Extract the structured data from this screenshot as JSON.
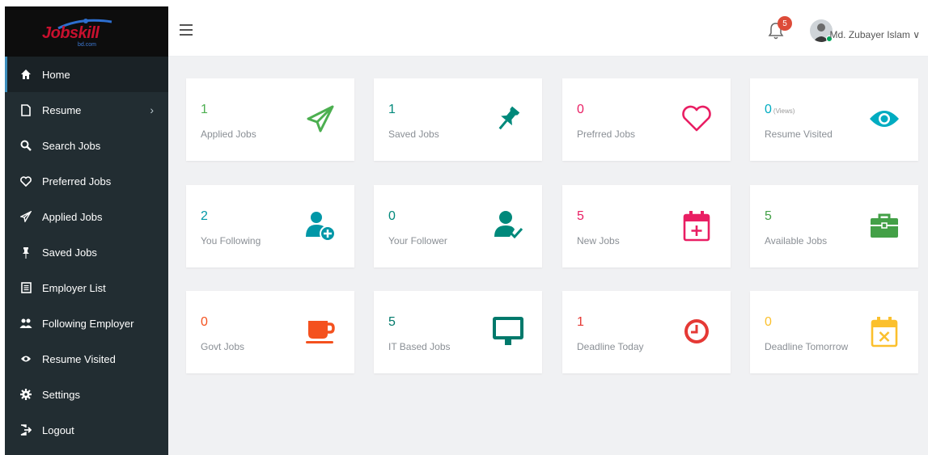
{
  "brand": {
    "logo_text": "Jobskill",
    "logo_sub": "bd.com"
  },
  "sidebar": {
    "items": [
      {
        "label": "Home",
        "icon": "home-icon"
      },
      {
        "label": "Resume",
        "icon": "file-icon"
      },
      {
        "label": "Search Jobs",
        "icon": "search-icon"
      },
      {
        "label": "Preferred Jobs",
        "icon": "heart-icon"
      },
      {
        "label": "Applied Jobs",
        "icon": "paper-plane-icon"
      },
      {
        "label": "Saved Jobs",
        "icon": "pushpin-icon"
      },
      {
        "label": "Employer List",
        "icon": "list-icon"
      },
      {
        "label": "Following Employer",
        "icon": "users-icon"
      },
      {
        "label": "Resume Visited",
        "icon": "eye-icon"
      },
      {
        "label": "Settings",
        "icon": "gear-icon"
      },
      {
        "label": "Logout",
        "icon": "logout-icon"
      }
    ],
    "chevron": "›"
  },
  "header": {
    "notification_count": "5",
    "user_name": "Md. Zubayer Islam ∨"
  },
  "cards": [
    {
      "value": "1",
      "suffix": "",
      "label": "Applied Jobs",
      "color": "#4caf50",
      "icon": "paper-plane-icon"
    },
    {
      "value": "1",
      "suffix": "",
      "label": "Saved Jobs",
      "color": "#00897b",
      "icon": "pushpin-icon"
    },
    {
      "value": "0",
      "suffix": "",
      "label": "Prefrred Jobs",
      "color": "#e91e63",
      "icon": "heart-icon"
    },
    {
      "value": "0",
      "suffix": "(Views)",
      "label": "Resume Visited",
      "color": "#00acc1",
      "icon": "eye-icon"
    },
    {
      "value": "2",
      "suffix": "",
      "label": "You Following",
      "color": "#0097a7",
      "icon": "add-user-icon"
    },
    {
      "value": "0",
      "suffix": "",
      "label": "Your Follower",
      "color": "#00897b",
      "icon": "user-check-icon"
    },
    {
      "value": "5",
      "suffix": "",
      "label": "New Jobs",
      "color": "#e91e63",
      "icon": "calendar-plus-icon"
    },
    {
      "value": "5",
      "suffix": "",
      "label": "Available Jobs",
      "color": "#43a047",
      "icon": "briefcase-icon"
    },
    {
      "value": "0",
      "suffix": "",
      "label": "Govt Jobs",
      "color": "#f4511e",
      "icon": "coffee-cup-icon"
    },
    {
      "value": "5",
      "suffix": "",
      "label": "IT Based Jobs",
      "color": "#00796b",
      "icon": "monitor-icon"
    },
    {
      "value": "1",
      "suffix": "",
      "label": "Deadline Today",
      "color": "#e53935",
      "icon": "clock-icon"
    },
    {
      "value": "0",
      "suffix": "",
      "label": "Deadline Tomorrow",
      "color": "#fbc02d",
      "icon": "calendar-x-icon"
    }
  ]
}
